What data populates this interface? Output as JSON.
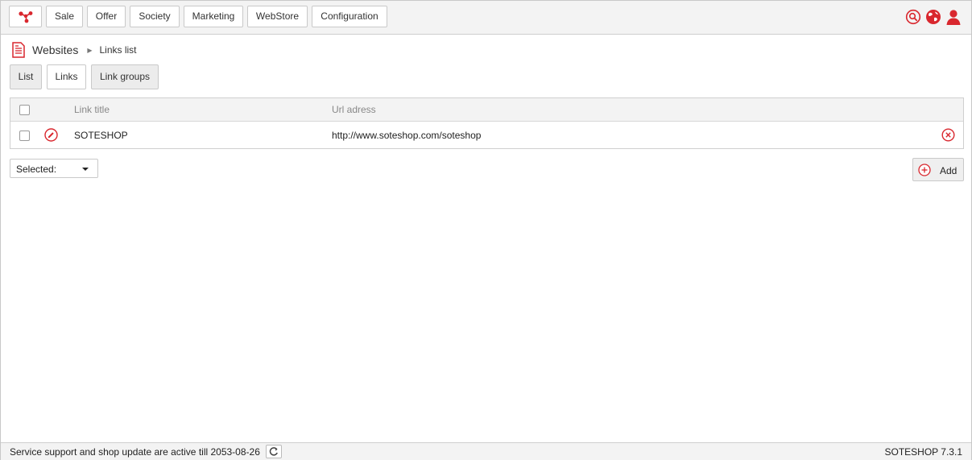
{
  "nav": {
    "menu": [
      "Sale",
      "Offer",
      "Society",
      "Marketing",
      "WebStore",
      "Configuration"
    ]
  },
  "icons": {
    "logo": "soteshop-logo-icon",
    "search": "search-icon",
    "globe": "globe-icon",
    "user": "user-icon",
    "page": "document-icon",
    "edit": "edit-icon",
    "delete": "delete-icon",
    "add": "add-icon",
    "refresh": "refresh-icon"
  },
  "colors": {
    "accent": "#d9272e",
    "bar": "#f3f3f3",
    "border": "#c9c9c9"
  },
  "breadcrumb": {
    "root": "Websites",
    "separator": "▶",
    "current": "Links list"
  },
  "tabs": [
    {
      "label": "List",
      "active": false
    },
    {
      "label": "Links",
      "active": true
    },
    {
      "label": "Link groups",
      "active": false
    }
  ],
  "table": {
    "columns": [
      "Link title",
      "Url adress"
    ],
    "rows": [
      {
        "title": "SOTESHOP",
        "url": "http://www.soteshop.com/soteshop"
      }
    ]
  },
  "actions": {
    "selected_label": "Selected:",
    "add_label": "Add"
  },
  "footer": {
    "support_text": "Service support and shop update are active till 2053-08-26",
    "version": "SOTESHOP 7.3.1"
  }
}
